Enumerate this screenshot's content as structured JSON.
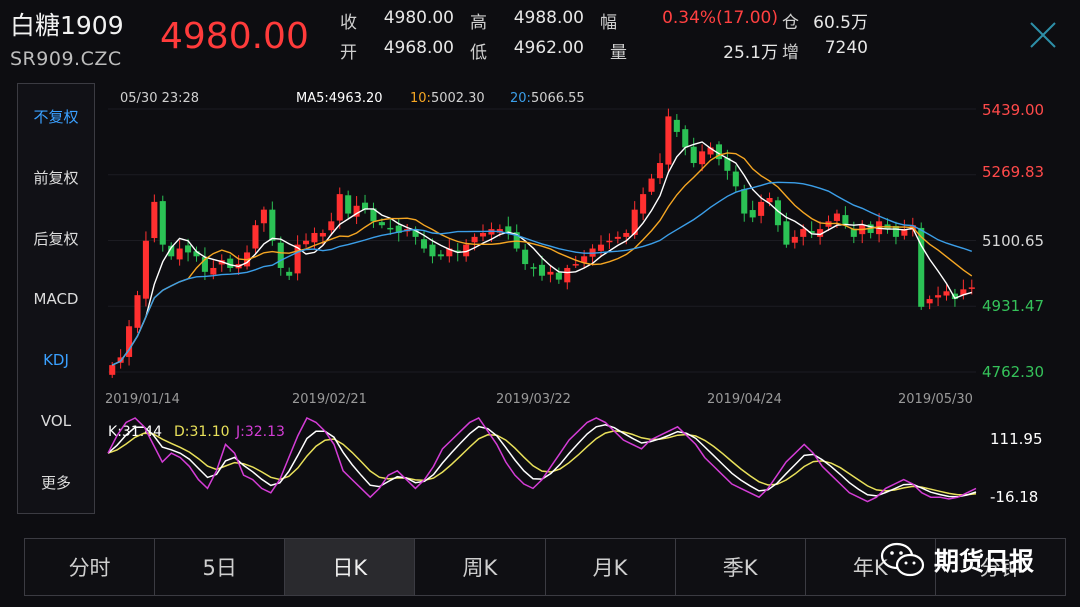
{
  "header": {
    "name": "白糖1909",
    "code": "SR909.CZC",
    "price": "4980.00",
    "stats": [
      {
        "label": "收",
        "value": "4980.00"
      },
      {
        "label": "高",
        "value": "4988.00"
      },
      {
        "label": "幅",
        "value": "0.34%(17.00)"
      },
      {
        "label": "仓",
        "value": "60.5万"
      },
      {
        "label": "开",
        "value": "4968.00"
      },
      {
        "label": "低",
        "value": "4962.00"
      },
      {
        "label": "量",
        "value": "25.1万"
      },
      {
        "label": "增",
        "value": "7240"
      }
    ]
  },
  "left_menu": {
    "items": [
      "不复权",
      "前复权",
      "后复权",
      "MACD",
      "KDJ",
      "VOL",
      "更多"
    ],
    "active": [
      "不复权",
      "KDJ"
    ]
  },
  "chart_info": {
    "datetime": "05/30 23:28",
    "ma": [
      {
        "label": "MA5",
        "value": "4963.20",
        "color": "#ffffff"
      },
      {
        "label": "10",
        "value": "5002.30",
        "color": "#f5a623"
      },
      {
        "label": "20",
        "value": "5066.55",
        "color": "#3b9ee8"
      }
    ]
  },
  "chart_data": [
    {
      "type": "candlestick",
      "y_ticks": [
        "5439.00",
        "5269.83",
        "5100.65",
        "4931.47",
        "4762.30"
      ],
      "ylim": [
        4762.3,
        5439.0
      ],
      "x_ticks": [
        "2019/01/14",
        "2019/02/21",
        "2019/03/22",
        "2019/04/24",
        "2019/05/30"
      ],
      "close": [
        4780,
        4800,
        4880,
        4960,
        5100,
        5200,
        5090,
        5060,
        5080,
        5070,
        5060,
        5020,
        5030,
        5050,
        5030,
        5040,
        5070,
        5140,
        5180,
        5100,
        5030,
        5010,
        5090,
        5100,
        5120,
        5120,
        5150,
        5220,
        5170,
        5190,
        5180,
        5150,
        5140,
        5130,
        5120,
        5130,
        5110,
        5080,
        5060,
        5060,
        5080,
        5070,
        5090,
        5110,
        5120,
        5130,
        5130,
        5120,
        5080,
        5040,
        5030,
        5010,
        5020,
        5000,
        5030,
        5040,
        5060,
        5080,
        5090,
        5100,
        5110,
        5120,
        5180,
        5220,
        5260,
        5300,
        5420,
        5380,
        5340,
        5300,
        5330,
        5340,
        5310,
        5280,
        5240,
        5170,
        5160,
        5200,
        5210,
        5140,
        5090,
        5110,
        5130,
        5120,
        5130,
        5150,
        5170,
        5140,
        5110,
        5140,
        5120,
        5150,
        5130,
        5110,
        5130,
        5140,
        4930,
        4950,
        4960,
        4970,
        4950,
        4975,
        4980
      ],
      "ma_series": [
        "MA5",
        "MA10",
        "MA20"
      ]
    },
    {
      "type": "line",
      "indicator": "KDJ",
      "series": [
        {
          "name": "K",
          "value": "31.44",
          "color": "#ffffff"
        },
        {
          "name": "D",
          "value": "31.10",
          "color": "#e8e05a"
        },
        {
          "name": "J",
          "value": "32.13",
          "color": "#d43dd6"
        }
      ],
      "y_ticks": [
        "111.95",
        "-16.18"
      ],
      "ylim": [
        -16.18,
        111.95
      ],
      "j_points": [
        60,
        80,
        95,
        100,
        90,
        70,
        50,
        60,
        55,
        45,
        30,
        20,
        40,
        70,
        60,
        35,
        30,
        20,
        15,
        30,
        55,
        80,
        100,
        95,
        85,
        70,
        40,
        30,
        20,
        10,
        20,
        35,
        40,
        30,
        20,
        30,
        45,
        65,
        75,
        85,
        95,
        100,
        85,
        70,
        50,
        35,
        25,
        20,
        30,
        45,
        60,
        75,
        85,
        95,
        100,
        95,
        85,
        75,
        70,
        65,
        75,
        80,
        85,
        90,
        80,
        70,
        55,
        45,
        35,
        25,
        20,
        15,
        10,
        20,
        35,
        50,
        60,
        70,
        60,
        45,
        35,
        25,
        15,
        10,
        5,
        10,
        20,
        25,
        30,
        25,
        15,
        10,
        10,
        8,
        10,
        15,
        20
      ]
    }
  ],
  "tabs": {
    "items": [
      "分时",
      "5日",
      "日K",
      "周K",
      "月K",
      "季K",
      "年K",
      "分钟"
    ],
    "active": "日K"
  },
  "watermark": {
    "text": "期货日报",
    "icon": "wechat-icon"
  }
}
